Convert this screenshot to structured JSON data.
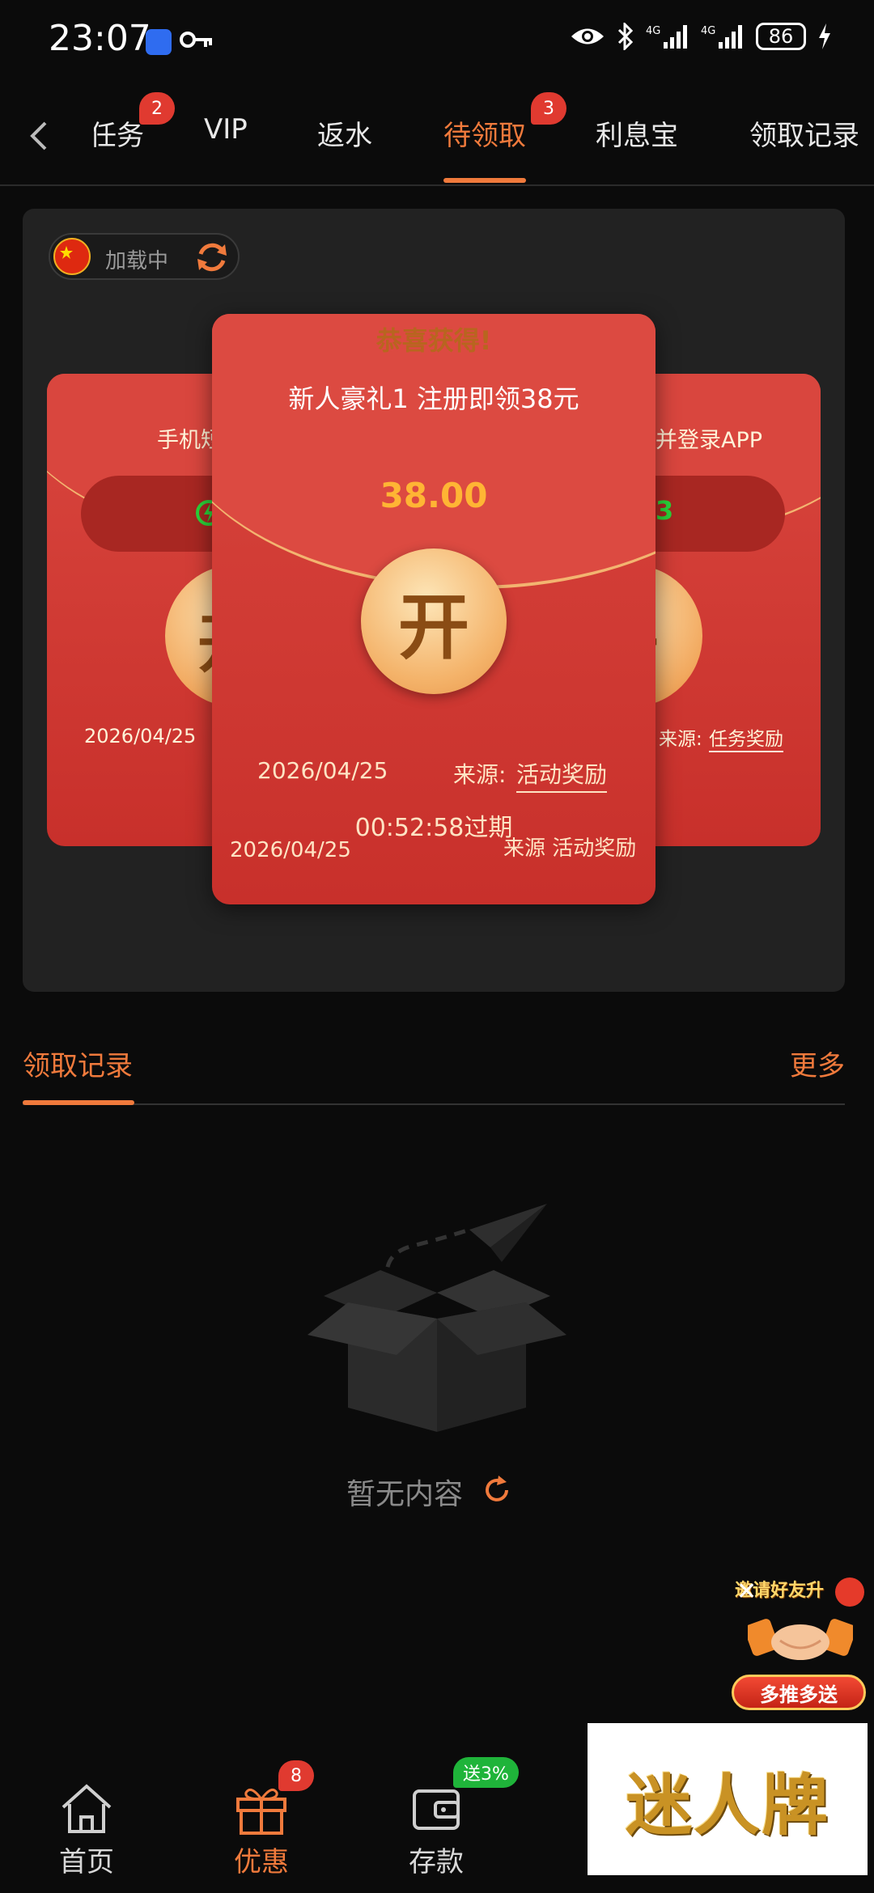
{
  "status_bar": {
    "time": "23:07",
    "battery": "86",
    "network": [
      "4G",
      "4G"
    ]
  },
  "tabs": [
    {
      "label": "任务",
      "badge": "2"
    },
    {
      "label": "VIP"
    },
    {
      "label": "返水"
    },
    {
      "label": "待领取",
      "badge": "3",
      "active": true
    },
    {
      "label": "利息宝"
    },
    {
      "label": "领取记录"
    }
  ],
  "lang_chip": {
    "text": "加载中"
  },
  "left_card": {
    "title": "手机短",
    "date": "2026/04/25"
  },
  "right_card": {
    "title": "并登录APP",
    "amount_fragment": "3",
    "source_label": "来源:",
    "source_link": "任务奖励"
  },
  "center_card": {
    "congrats": "恭喜获得!",
    "title": "新人豪礼1 注册即领38元",
    "amount": "38.00",
    "open_label": "开",
    "date": "2026/04/25",
    "source_label": "来源:",
    "source_link": "活动奖励",
    "expire": "00:52:58过期",
    "date2": "2026/04/25",
    "source2": "来源  活动奖励"
  },
  "records": {
    "title": "领取记录",
    "more": "更多",
    "empty": "暂无内容"
  },
  "promo": {
    "top_text": "邀请好友升",
    "close": "✕",
    "button": "多推多送"
  },
  "bottom_nav": [
    {
      "label": "首页",
      "icon": "home-icon"
    },
    {
      "label": "优惠",
      "icon": "gift-icon",
      "badge": "8",
      "active": true
    },
    {
      "label": "存款",
      "icon": "wallet-icon",
      "badge": "送3%"
    }
  ],
  "brand": {
    "text": "迷人牌"
  },
  "colors": {
    "accent": "#f07a3c",
    "card_red": "#d9463e",
    "gold": "#ffb534",
    "badge_red": "#e03a30",
    "green": "#1fb43a"
  }
}
